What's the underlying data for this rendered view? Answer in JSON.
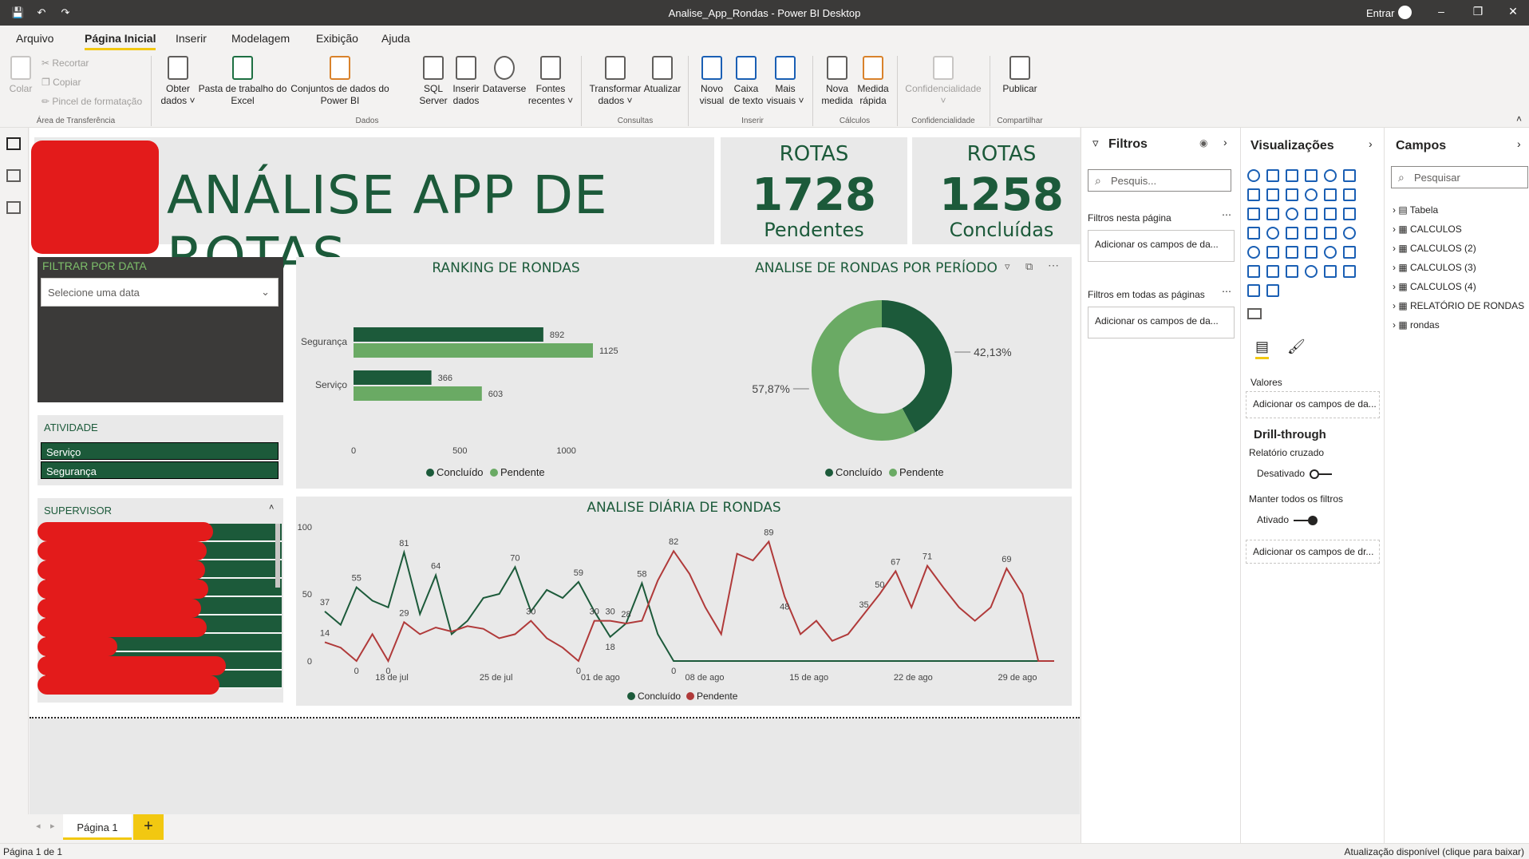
{
  "window": {
    "title": "Analise_App_Rondas - Power BI Desktop",
    "signin": "Entrar"
  },
  "menu": {
    "items": [
      "Arquivo",
      "Página Inicial",
      "Inserir",
      "Modelagem",
      "Exibição",
      "Ajuda"
    ],
    "active": "Página Inicial"
  },
  "ribbon": {
    "clipboard": {
      "paste": "Colar",
      "cut": "Recortar",
      "copy": "Copiar",
      "format_painter": "Pincel de formatação",
      "group": "Área de Transferência"
    },
    "data": {
      "get_data": "Obter dados",
      "excel": "Pasta de trabalho do Excel",
      "datasets": "Conjuntos de dados do Power BI",
      "sql": "SQL Server",
      "enter_data": "Inserir dados",
      "dataverse": "Dataverse",
      "recent": "Fontes recentes",
      "group": "Dados"
    },
    "queries": {
      "transform": "Transformar dados",
      "refresh": "Atualizar",
      "group": "Consultas"
    },
    "insert": {
      "new_visual": "Novo visual",
      "text_box": "Caixa de texto",
      "more_visuals": "Mais visuais",
      "group": "Inserir"
    },
    "calc": {
      "new_measure": "Nova medida",
      "quick_measure": "Medida rápida",
      "group": "Cálculos"
    },
    "sensitivity": {
      "label": "Confidencialidade",
      "group": "Confidencialidade"
    },
    "share": {
      "publish": "Publicar",
      "group": "Compartilhar"
    }
  },
  "report": {
    "title": "ANÁLISE APP DE ROTAS",
    "kpi1": {
      "header": "ROTAS",
      "value": "1728",
      "label": "Pendentes"
    },
    "kpi2": {
      "header": "ROTAS",
      "value": "1258",
      "label": "Concluídas"
    },
    "date_slicer": {
      "title": "FILTRAR POR DATA",
      "placeholder": "Selecione uma data"
    },
    "activity_slicer": {
      "title": "ATIVIDADE",
      "items": [
        "Serviço",
        "Segurança"
      ]
    },
    "supervisor_slicer": {
      "title": "SUPERVISOR"
    }
  },
  "colors": {
    "concluido": "#1c5a3a",
    "pendente": "#6aaa64",
    "pendente_line": "#b03a3a",
    "accent": "#f2c811"
  },
  "chart_data": [
    {
      "type": "bar",
      "title": "RANKING DE RONDAS",
      "categories": [
        "Segurança",
        "Serviço"
      ],
      "series": [
        {
          "name": "Concluído",
          "values": [
            892,
            366
          ]
        },
        {
          "name": "Pendente",
          "values": [
            1125,
            603
          ]
        }
      ],
      "xticks": [
        "0",
        "500",
        "1000"
      ],
      "xlim": [
        0,
        1200
      ],
      "legend": "bottom"
    },
    {
      "type": "pie",
      "title": "ANALISE DE RONDAS POR PERÍODO",
      "slices": [
        {
          "name": "Concluído",
          "value": 42.13,
          "label": "42,13%"
        },
        {
          "name": "Pendente",
          "value": 57.87,
          "label": "57,87%"
        }
      ],
      "legend": "bottom"
    },
    {
      "type": "line",
      "title": "ANALISE DIÁRIA DE RONDAS",
      "x_ticks": [
        "18 de jul",
        "25 de jul",
        "01 de ago",
        "08 de ago",
        "15 de ago",
        "22 de ago",
        "29 de ago"
      ],
      "yticks": [
        "0",
        "50",
        "100"
      ],
      "ylim": [
        0,
        100
      ],
      "series": [
        {
          "name": "Concluído",
          "values": [
            37,
            27,
            55,
            45,
            40,
            81,
            35,
            64,
            20,
            30,
            47,
            50,
            70,
            37,
            53,
            47,
            59,
            37,
            18,
            28,
            58,
            20,
            0,
            0,
            0,
            0,
            0,
            0,
            0,
            0,
            0,
            0,
            0,
            0,
            0,
            0,
            0,
            0,
            0,
            0,
            0,
            0,
            0,
            0,
            0,
            0,
            0
          ]
        },
        {
          "name": "Pendente",
          "values": [
            14,
            10,
            0,
            20,
            0,
            29,
            20,
            25,
            22,
            26,
            24,
            17,
            20,
            30,
            17,
            10,
            0,
            30,
            30,
            28,
            30,
            60,
            82,
            65,
            40,
            20,
            80,
            75,
            89,
            48,
            20,
            30,
            15,
            20,
            35,
            50,
            67,
            40,
            71,
            55,
            40,
            30,
            40,
            69,
            50,
            0,
            0
          ]
        }
      ],
      "point_labels": {
        "Concluído": [
          "37",
          "55",
          "81",
          "64",
          "24",
          "70",
          "59",
          "18",
          "28",
          "58",
          "0"
        ],
        "Pendente": [
          "14",
          "0",
          "29",
          "35",
          "30",
          "0",
          "82",
          "27",
          "89",
          "48",
          "30",
          "67",
          "71",
          "30",
          "69",
          "50",
          "0"
        ]
      },
      "legend": "bottom"
    }
  ],
  "filters_pane": {
    "title": "Filtros",
    "search": "Pesquis...",
    "on_page": "Filtros nesta página",
    "add_fields": "Adicionar os campos de da...",
    "all_pages": "Filtros em todas as páginas",
    "add_fields2": "Adicionar os campos de da..."
  },
  "vis_pane": {
    "title": "Visualizações",
    "values_label": "Valores",
    "add_fields": "Adicionar os campos de da...",
    "drill": "Drill-through",
    "cross_report": "Relatório cruzado",
    "off": "Desativado",
    "keep_filters": "Manter todos os filtros",
    "on": "Ativado",
    "add_drill": "Adicionar os campos de dr..."
  },
  "fields_pane": {
    "title": "Campos",
    "search": "Pesquisar",
    "tables": [
      "Tabela",
      "CALCULOS",
      "CALCULOS (2)",
      "CALCULOS (3)",
      "CALCULOS (4)",
      "RELATÓRIO DE RONDAS",
      "rondas"
    ]
  },
  "tabs": {
    "page1": "Página 1",
    "add": "+"
  },
  "status": {
    "left": "Página 1 de 1",
    "right": "Atualização disponível (clique para baixar)"
  }
}
